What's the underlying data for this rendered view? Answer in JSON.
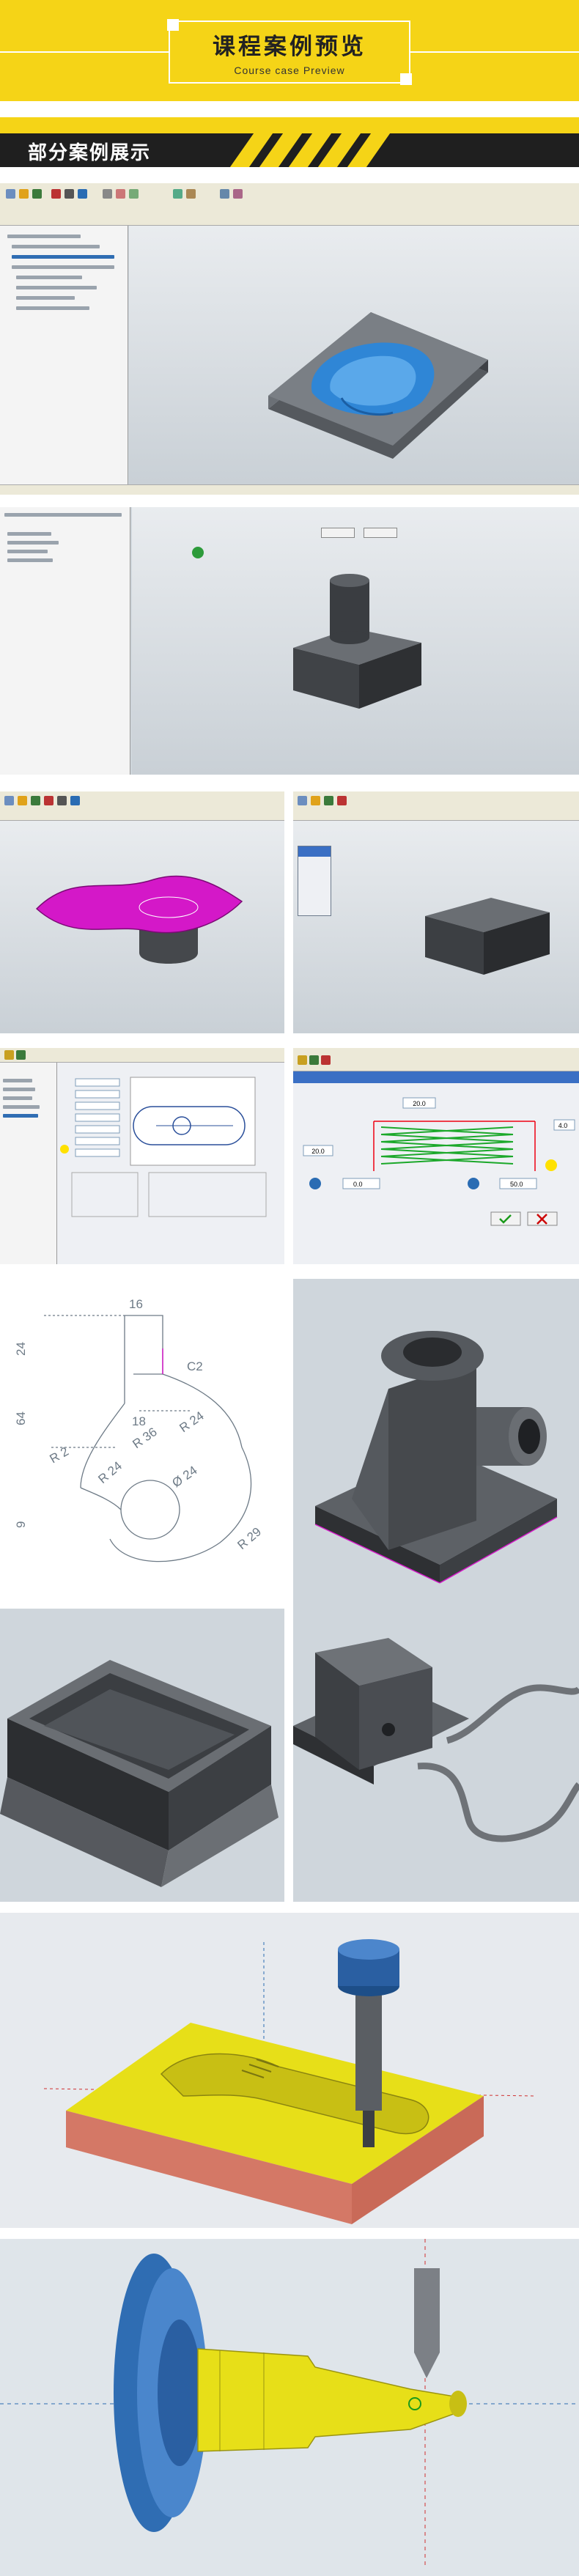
{
  "header": {
    "title": "课程案例预览",
    "subtitle": "Course case Preview"
  },
  "section": {
    "title": "部分案例展示"
  },
  "colors": {
    "accent_yellow": "#f5d417",
    "bar_dark": "#1f1f1f",
    "cad_background": "#cfd6dc",
    "part_gray": "#4a4d52",
    "part_blue": "#2f86d6",
    "part_magenta": "#d418c8",
    "part_yellow": "#e7df18",
    "part_salmon": "#d47866"
  },
  "screens": {
    "s1_icons": [
      "file-icon",
      "open-icon",
      "save-icon",
      "measure-icon",
      "sketch-icon",
      "solid-icon"
    ],
    "s7_labels": {
      "a": "20.0",
      "b": "4.0",
      "c": "20.0",
      "d": "0.0",
      "e": "50.0"
    }
  },
  "drawing": {
    "dims": [
      "16",
      "C2",
      "24",
      "64",
      "R 2",
      "R 36",
      "R 24",
      "18",
      "R 24",
      "Ø 24",
      "9",
      "R 29"
    ]
  }
}
